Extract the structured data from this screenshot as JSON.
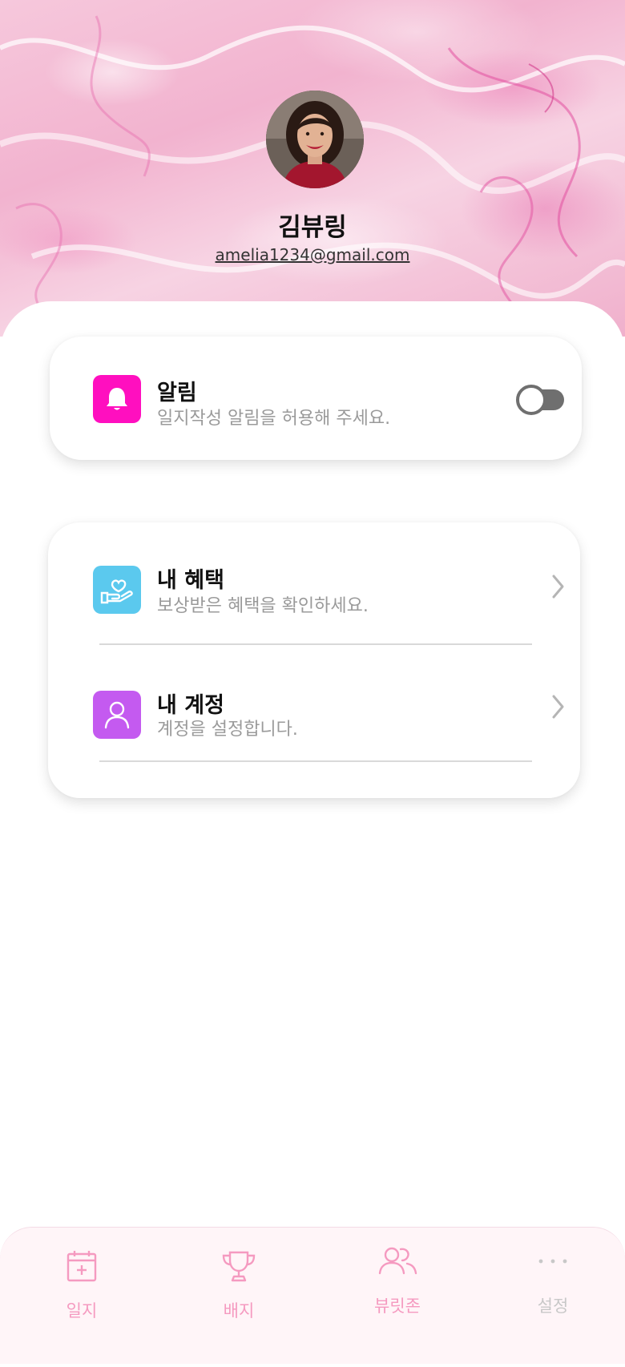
{
  "profile": {
    "name": "김뷰링",
    "email": "amelia1234@gmail.com"
  },
  "notification": {
    "title": "알림",
    "subtitle": "일지작성 알림을 허용해 주세요.",
    "toggle_on": false,
    "icon": "bell-icon",
    "color": "#ff0fbf"
  },
  "menu": {
    "items": [
      {
        "title": "내 혜택",
        "subtitle": "보상받은 혜택을 확인하세요.",
        "icon": "gift-hand-icon",
        "color": "#5bc9ee"
      },
      {
        "title": "내 계정",
        "subtitle": "계정을 설정합니다.",
        "icon": "user-icon",
        "color": "#c45af0"
      }
    ]
  },
  "tabbar": {
    "tabs": [
      {
        "label": "일지",
        "icon": "calendar-plus-icon",
        "color": "#f59ac0"
      },
      {
        "label": "배지",
        "icon": "trophy-icon",
        "color": "#f59ac0"
      },
      {
        "label": "뷰릿존",
        "icon": "users-icon",
        "color": "#f59ac0"
      },
      {
        "label": "설정",
        "icon": "more-dots-icon",
        "color": "#c8c8c8"
      }
    ]
  }
}
